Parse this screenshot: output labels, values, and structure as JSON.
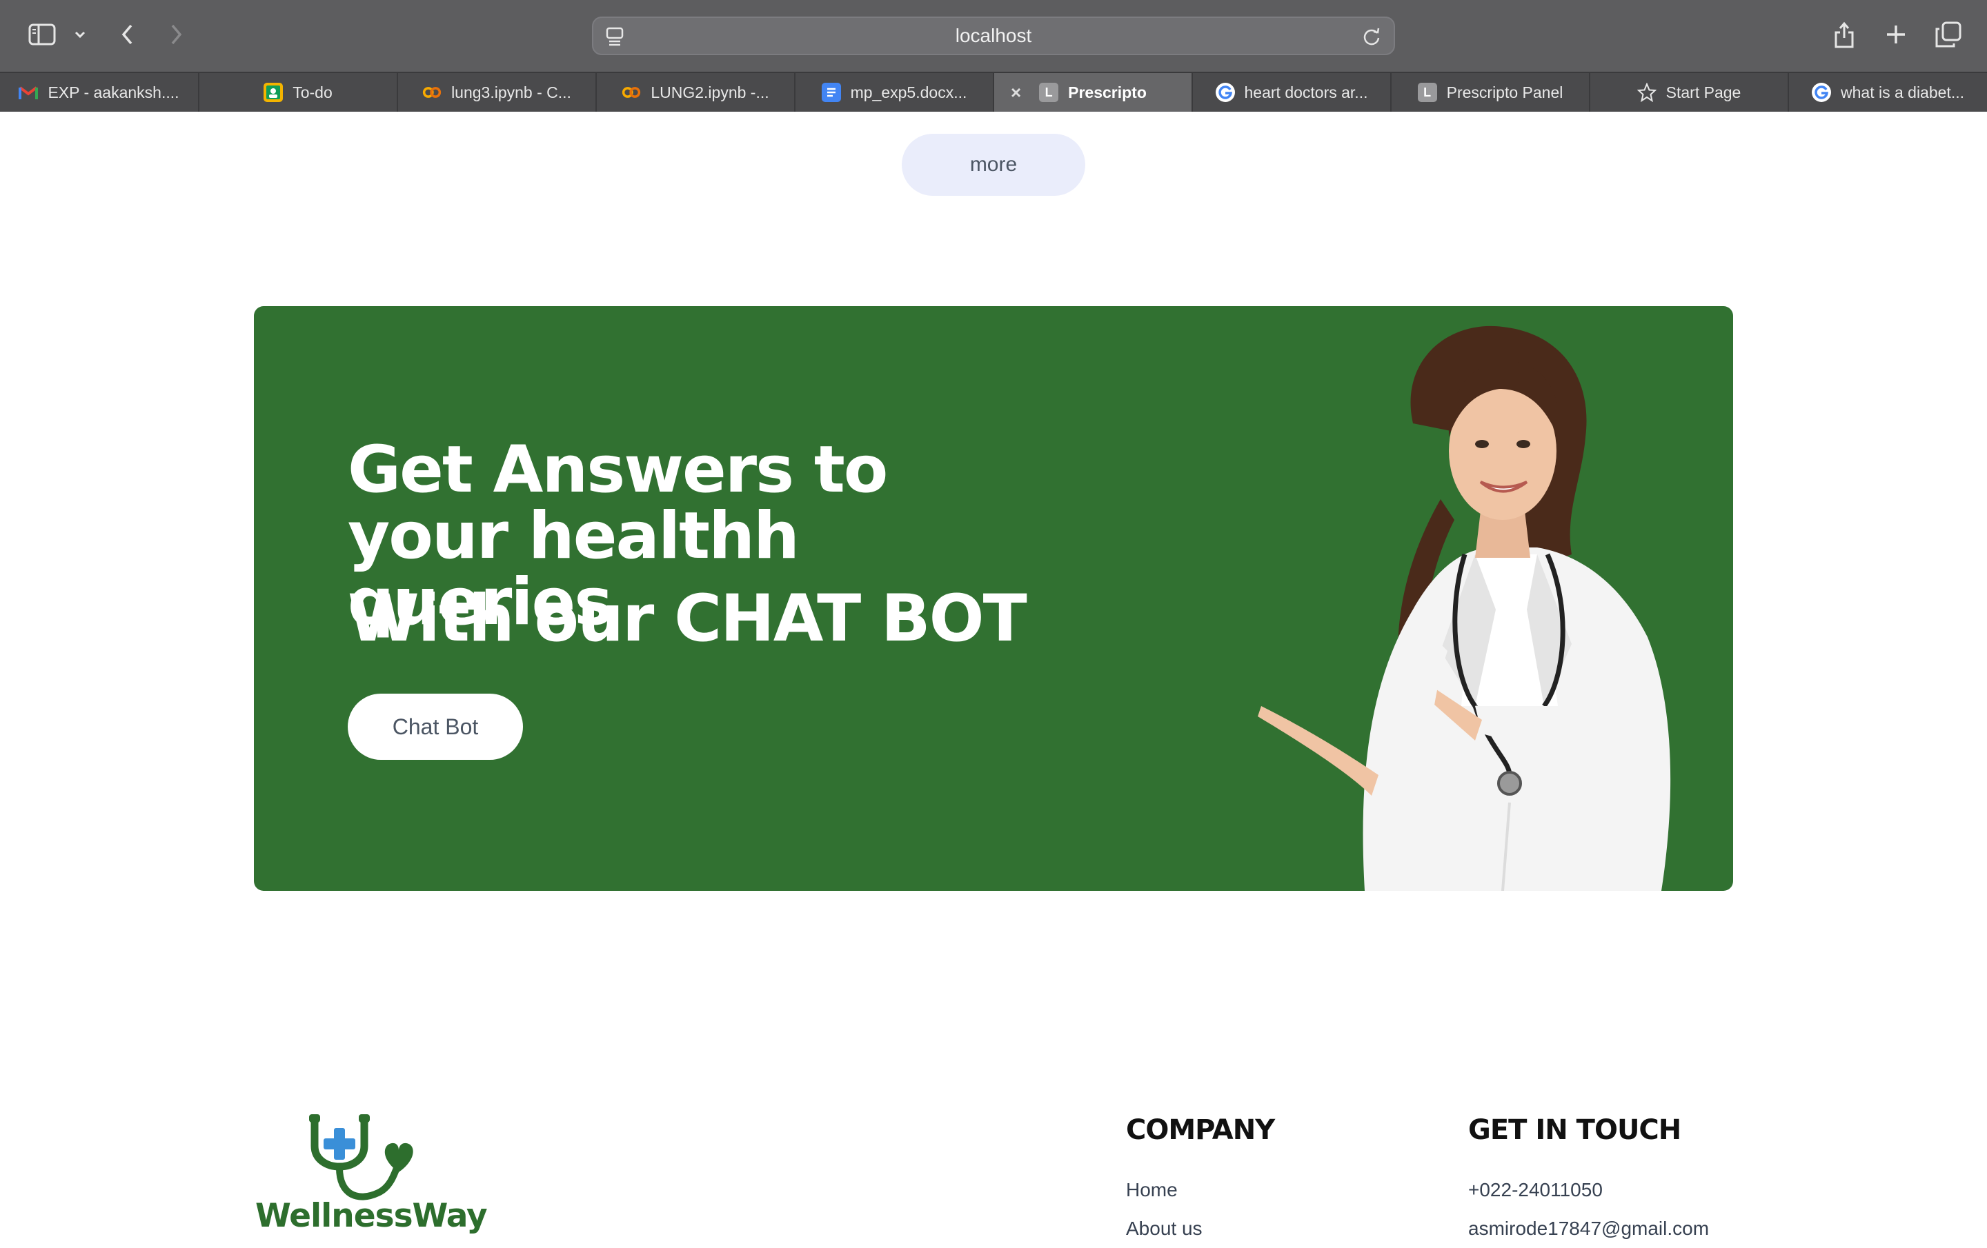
{
  "browser": {
    "url": "localhost",
    "tabs": [
      {
        "label": "EXP - aakanksh....",
        "icon": "gmail-icon",
        "active": false
      },
      {
        "label": "To-do",
        "icon": "classroom-icon",
        "active": false
      },
      {
        "label": "lung3.ipynb - C...",
        "icon": "colab-icon",
        "active": false
      },
      {
        "label": "LUNG2.ipynb -...",
        "icon": "colab-icon",
        "active": false
      },
      {
        "label": "mp_exp5.docx...",
        "icon": "docs-icon",
        "active": false
      },
      {
        "label": "Prescripto",
        "icon": "letter-l-icon",
        "active": true
      },
      {
        "label": "heart doctors ar...",
        "icon": "google-icon",
        "active": false
      },
      {
        "label": "Prescripto Panel",
        "icon": "letter-l-icon",
        "active": false
      },
      {
        "label": "Start Page",
        "icon": "star-icon",
        "active": false
      },
      {
        "label": "what is a diabet...",
        "icon": "google-icon",
        "active": false
      }
    ],
    "tab_close_glyph": "×",
    "favicon_letter": "L"
  },
  "page": {
    "more_label": "more",
    "banner": {
      "heading": "Get Answers to your healthh queries",
      "subheading": "With our CHAT BOT",
      "button_label": "Chat Bot",
      "background": "#317131"
    },
    "footer": {
      "logo_text": "WellnessWay",
      "company": {
        "title": "COMPANY",
        "items": [
          "Home",
          "About us"
        ]
      },
      "contact": {
        "title": "GET IN TOUCH",
        "items": [
          "+022-24011050",
          "asmirode17847@gmail.com"
        ]
      }
    }
  },
  "colors": {
    "accent_green": "#317131",
    "logo_green": "#2d6e2d",
    "logo_blue": "#3a8fd8",
    "more_bg": "#eaedfb"
  }
}
